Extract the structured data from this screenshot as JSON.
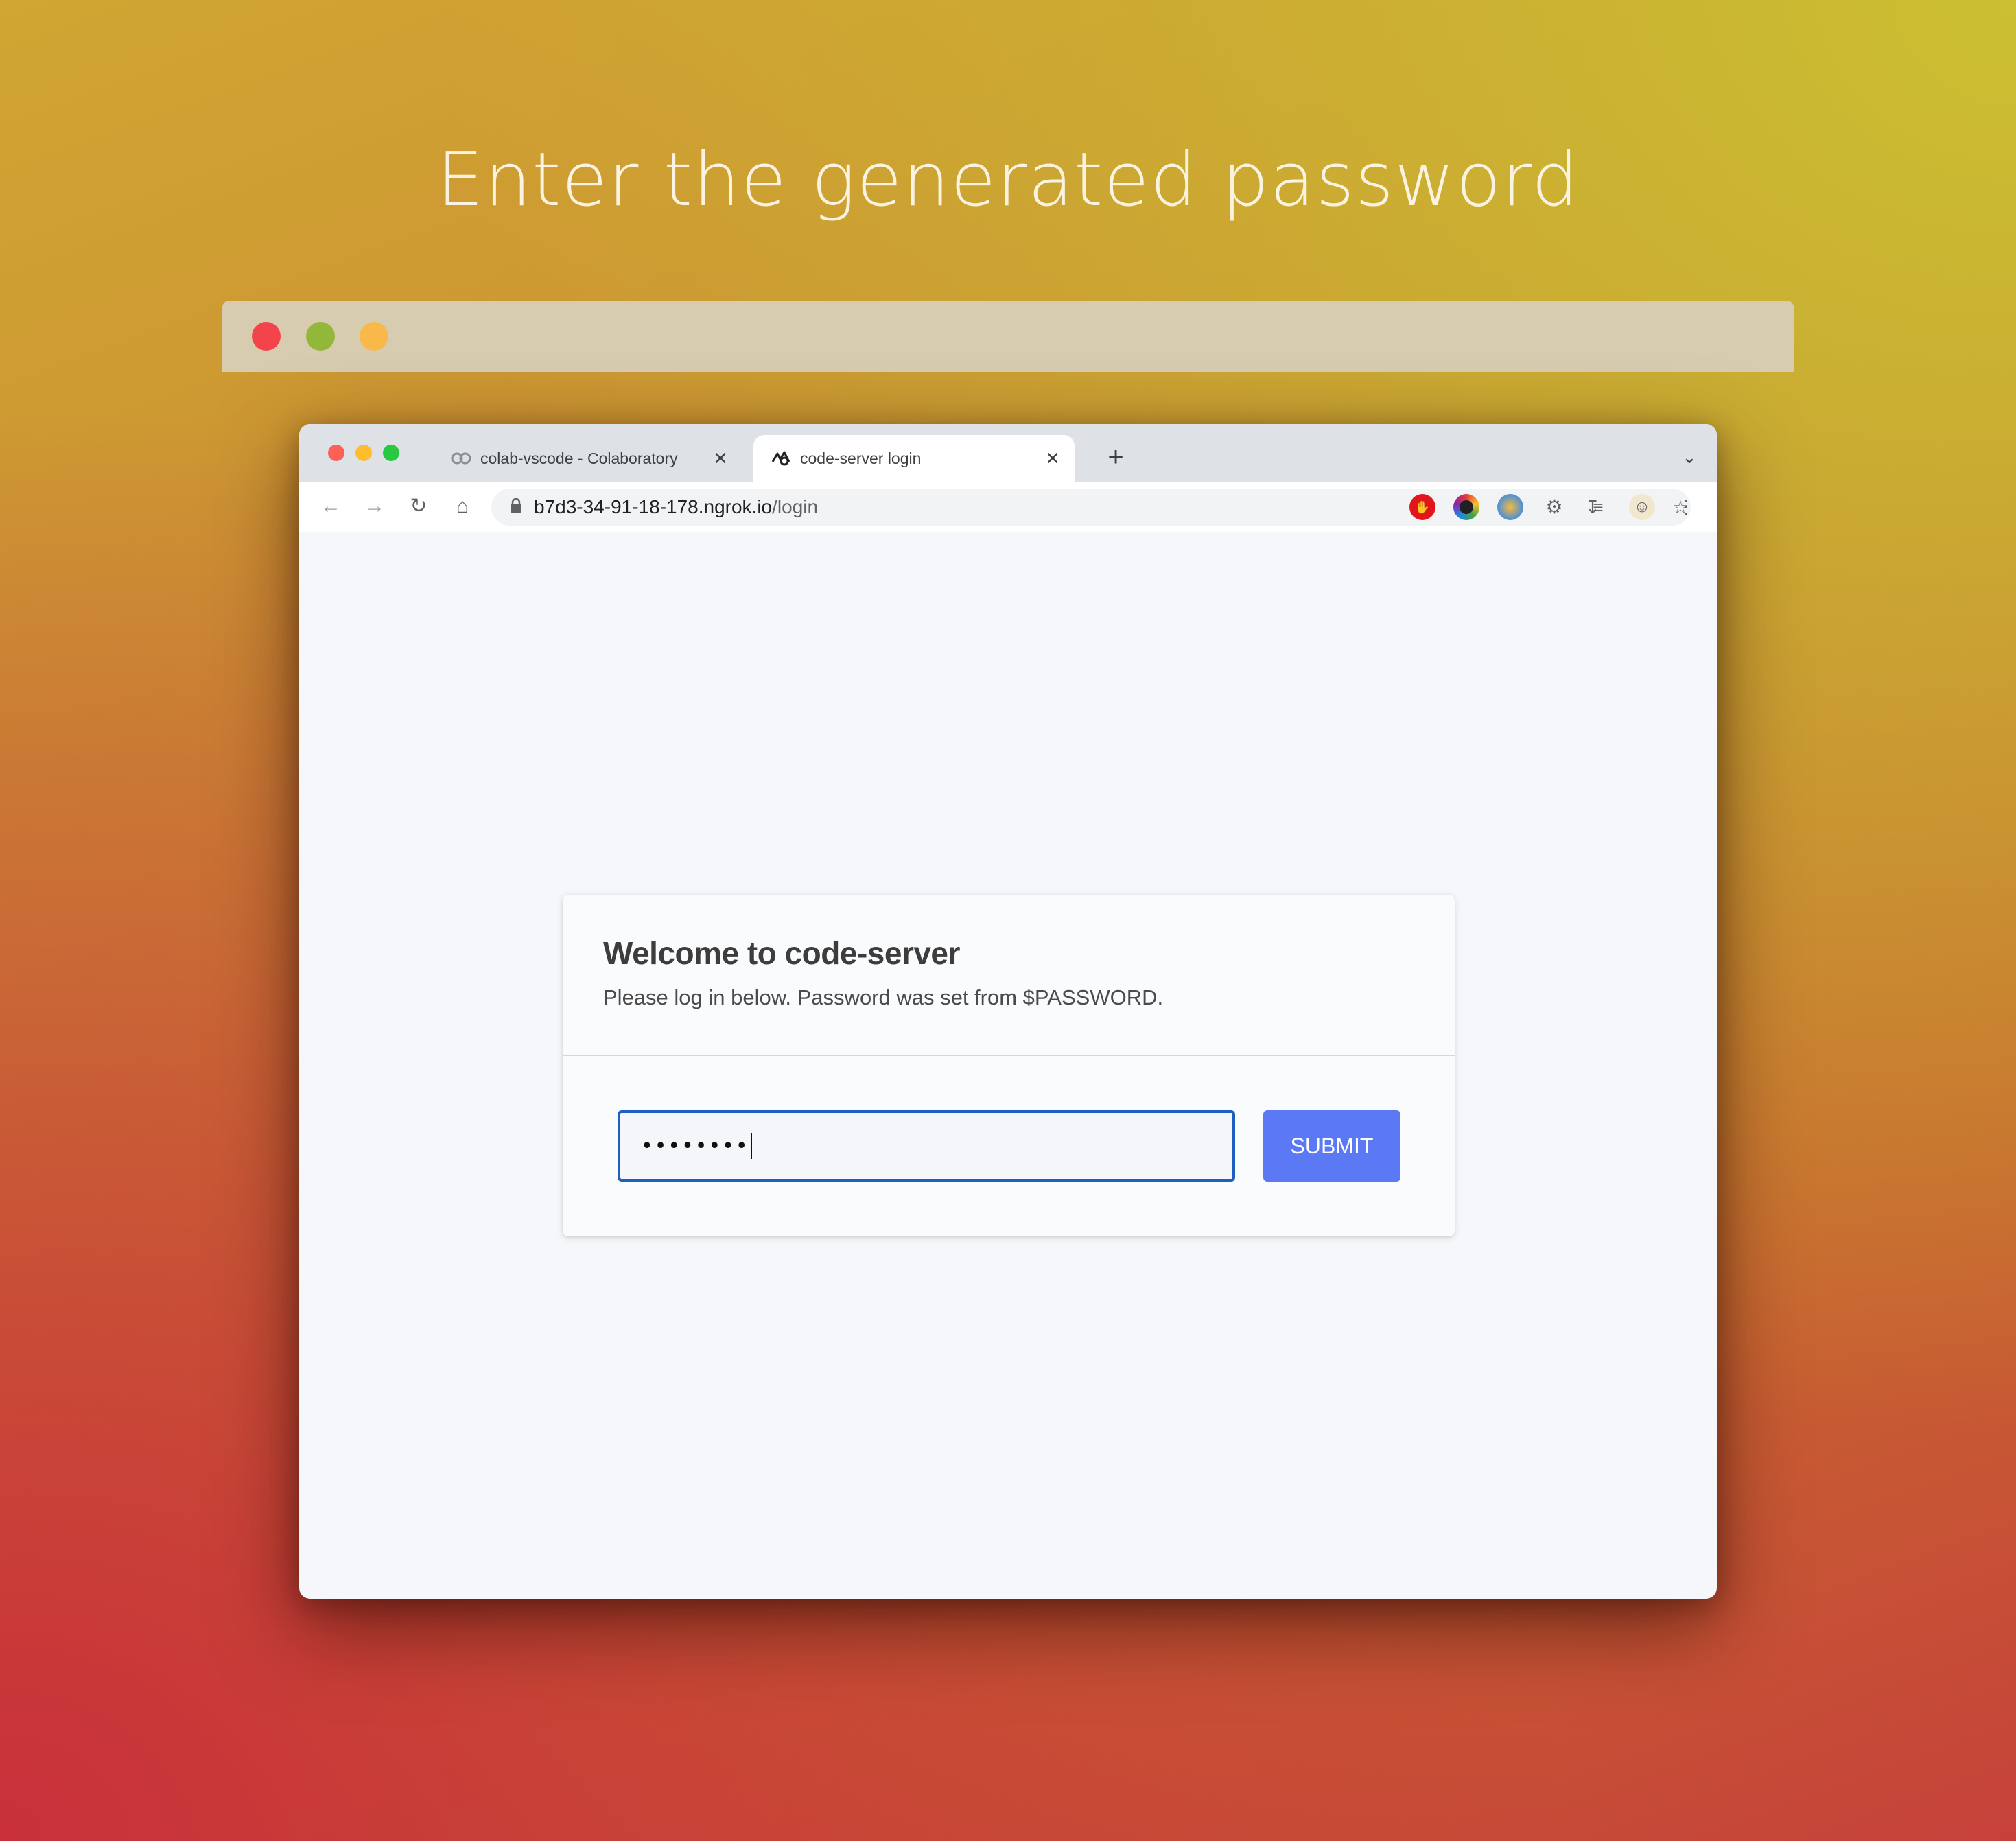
{
  "headline": "Enter the generated password",
  "browser": {
    "tabs": [
      {
        "label": "colab-vscode - Colaboratory",
        "icon": "colab-icon",
        "active": false
      },
      {
        "label": "code-server login",
        "icon": "code-server-icon",
        "active": true
      }
    ],
    "close_glyph": "✕",
    "new_tab_glyph": "+",
    "tab_menu_glyph": "⌄",
    "url_host": "b7d3-34-91-18-178.ngrok.io",
    "url_path": "/login"
  },
  "login": {
    "title": "Welcome to code-server",
    "subtitle": "Please log in below. Password was set from $PASSWORD.",
    "password_masked": "••••••••",
    "submit_label": "SUBMIT"
  },
  "colors": {
    "submit": "#5b78f5",
    "input_border": "#1f5fbf",
    "outer_red": "#f4444b",
    "outer_green": "#93b73a",
    "outer_yellow": "#f9b84a"
  }
}
